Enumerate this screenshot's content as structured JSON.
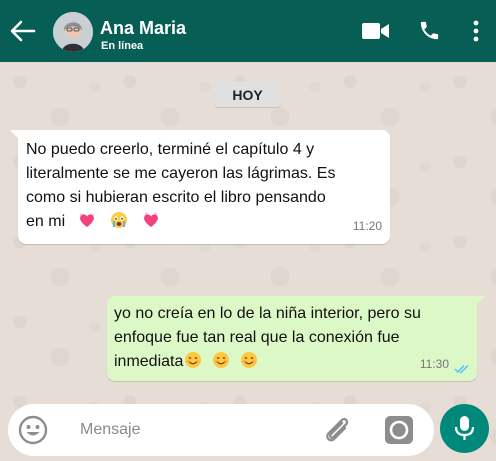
{
  "header": {
    "name": "Ana Maria",
    "status": "En línea"
  },
  "date_chip": "HOY",
  "messages": [
    {
      "direction": "incoming",
      "lines": [
        "No puedo creerlo, terminé el capítulo 4 y",
        "literalmente se me cayeron las lágrimas. Es",
        "como si hubieran escrito el libro pensando",
        "en mi"
      ],
      "emojis": [
        "heart-eyes-heart-icon",
        "crying-face-icon",
        "heart-icon"
      ],
      "time": "11:20"
    },
    {
      "direction": "outgoing",
      "lines": [
        "yo no creía en lo de la niña interior, pero su",
        "enfoque fue tan real que la conexión fue",
        "inmediata"
      ],
      "emojis": [
        "smiling-face-icon",
        "smiling-face-icon",
        "smiling-face-icon"
      ],
      "time": "11:30",
      "read": true
    }
  ],
  "composer": {
    "placeholder": "Mensaje"
  },
  "colors": {
    "header": "#075e54",
    "outgoing_bubble": "#dcf8c6",
    "mic_button": "#00897b",
    "read_ticks": "#4fc3f7"
  }
}
